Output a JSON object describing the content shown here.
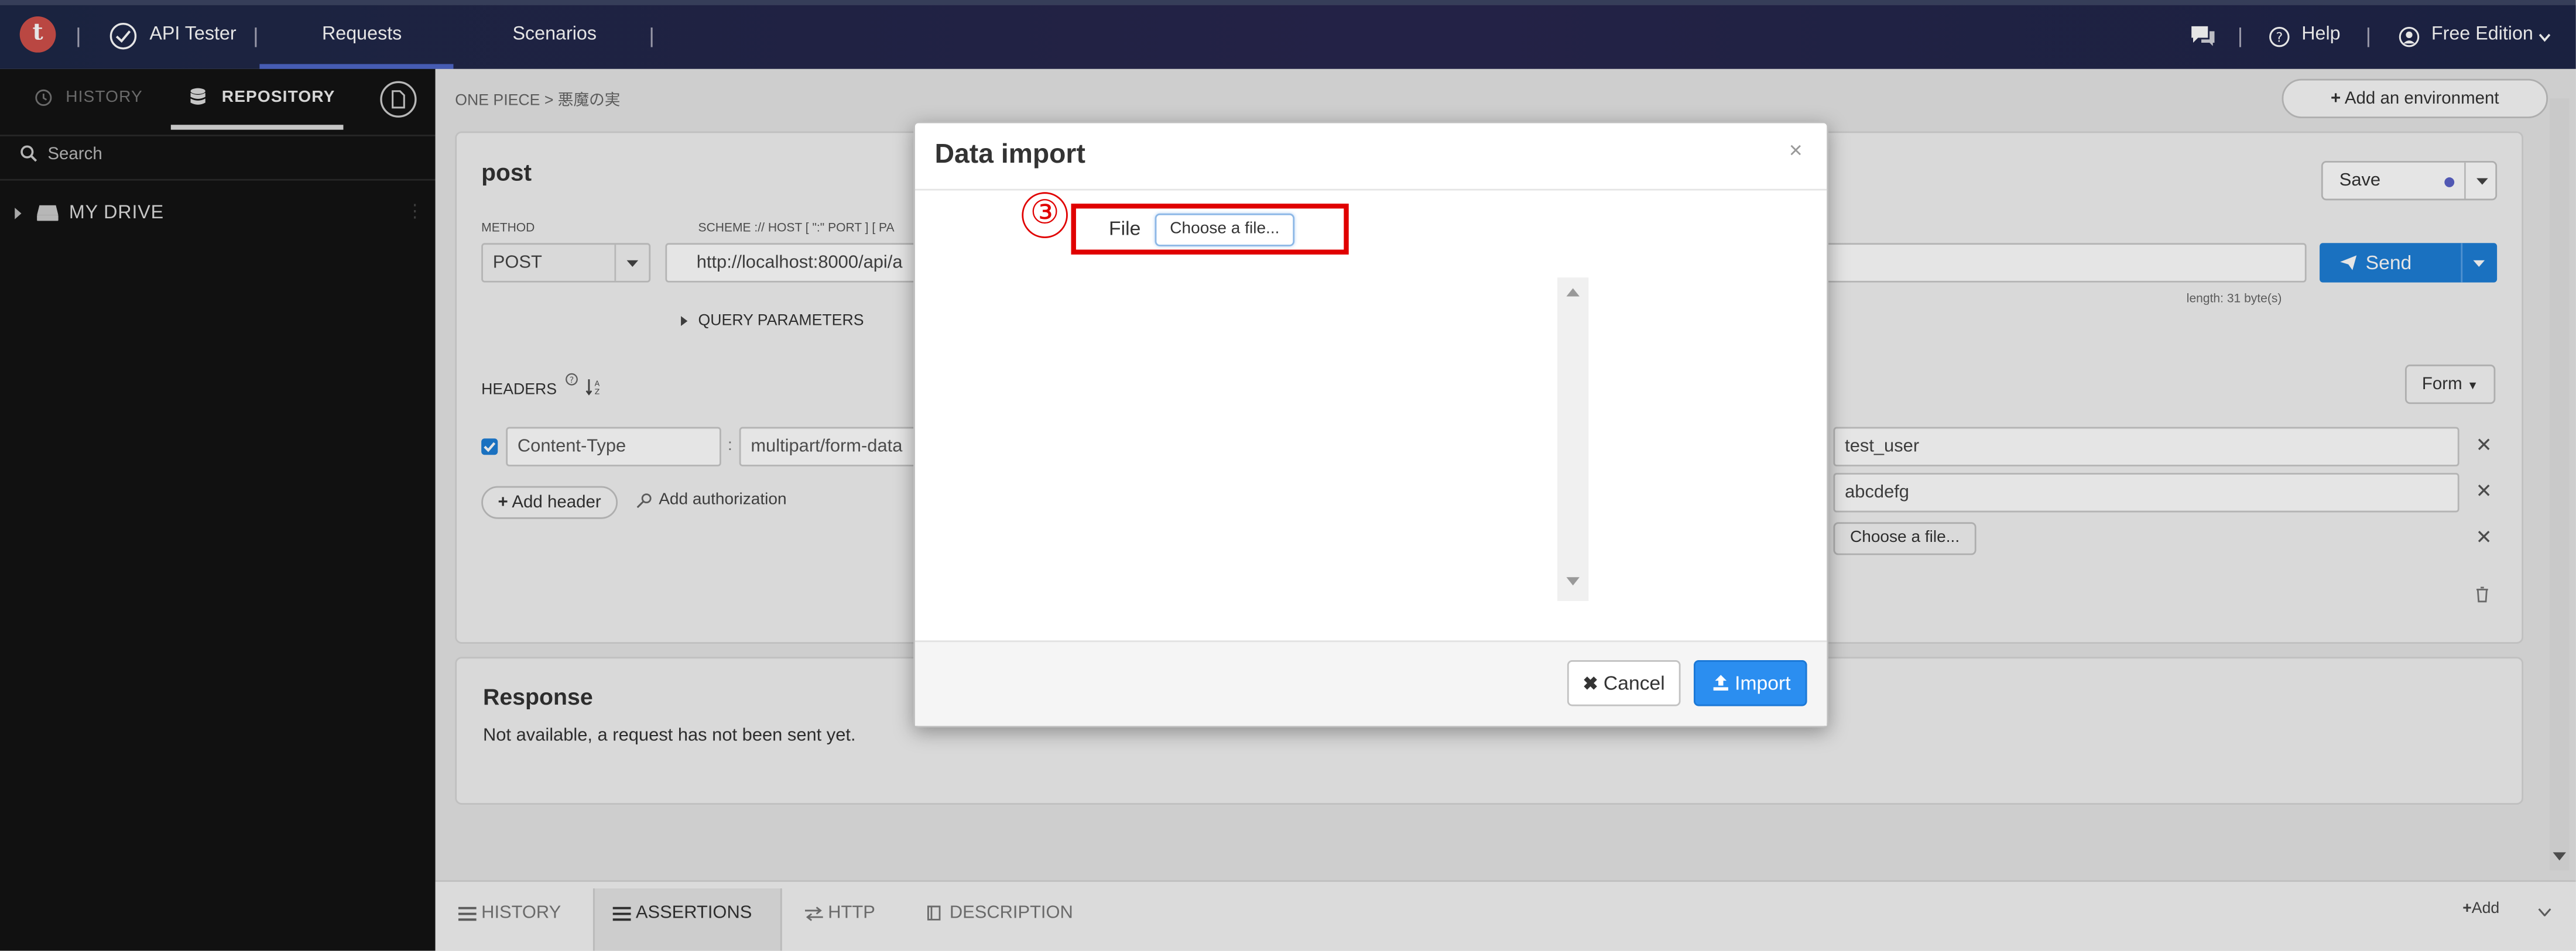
{
  "topbar": {
    "logo_letter": "t",
    "app_name": "API Tester",
    "tabs": [
      "Requests",
      "Scenarios"
    ],
    "help": "Help",
    "edition": "Free Edition"
  },
  "sidebar": {
    "tab_history": "HISTORY",
    "tab_repository": "REPOSITORY",
    "search_placeholder": "Search",
    "drive": "MY DRIVE"
  },
  "main": {
    "breadcrumb": "ONE PIECE > 悪魔の実",
    "add_environment": "Add an environment",
    "request_name": "post",
    "save": "Save",
    "method_label": "METHOD",
    "method_value": "POST",
    "url_label": "SCHEME :// HOST [ \":\" PORT ] [ PA",
    "url_value": "http://localhost:8000/api/a",
    "send": "Send",
    "length_text": "length: 31 byte(s)",
    "query_parameters": "QUERY PARAMETERS",
    "headers_label": "HEADERS",
    "form_dropdown": "Form",
    "header_key": "Content-Type",
    "header_value": "multipart/form-data",
    "add_header": "Add header",
    "add_authorization": "Add authorization",
    "body_values": [
      "test_user",
      "abcdefg"
    ],
    "body_file_button": "Choose a file...",
    "response_title": "Response",
    "response_text": "Not available, a request has not been sent yet.",
    "bottom_tabs": [
      "HISTORY",
      "ASSERTIONS",
      "HTTP",
      "DESCRIPTION"
    ],
    "bottom_add": "Add"
  },
  "modal": {
    "title": "Data import",
    "close": "×",
    "file_label": "File",
    "choose_file": "Choose a file...",
    "annotation": "③",
    "cancel": "Cancel",
    "import": "Import"
  },
  "colors": {
    "topbar": "#1e2747",
    "accent_blue": "#1e7ed6",
    "annotation_red": "#e00000",
    "sidebar_bg": "#141414"
  }
}
